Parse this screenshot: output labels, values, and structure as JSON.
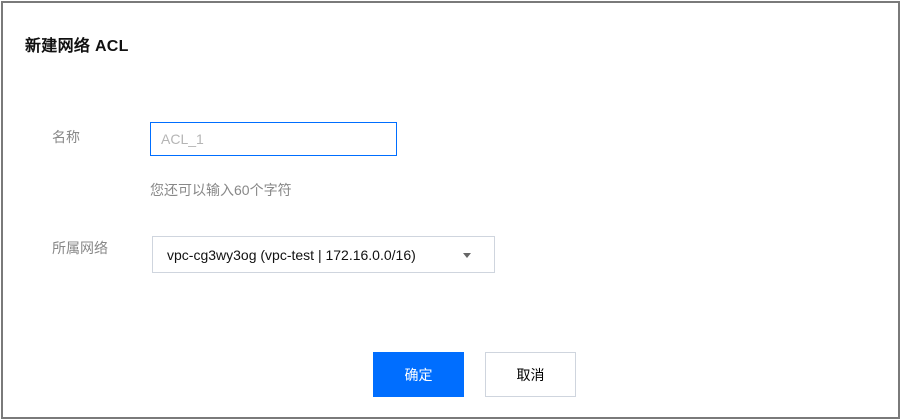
{
  "dialog": {
    "title": "新建网络 ACL"
  },
  "form": {
    "name_label": "名称",
    "name_input": {
      "value": "",
      "placeholder": "ACL_1"
    },
    "name_hint": "您还可以输入60个字符",
    "vpc_label": "所属网络",
    "vpc_select": {
      "selected": "vpc-cg3wy3og (vpc-test | 172.16.0.0/16)",
      "icon": "chevron-down-icon"
    }
  },
  "footer": {
    "confirm_label": "确定",
    "cancel_label": "取消"
  },
  "colors": {
    "primary": "#006eff",
    "border": "#cfd5de",
    "label": "#888888"
  }
}
